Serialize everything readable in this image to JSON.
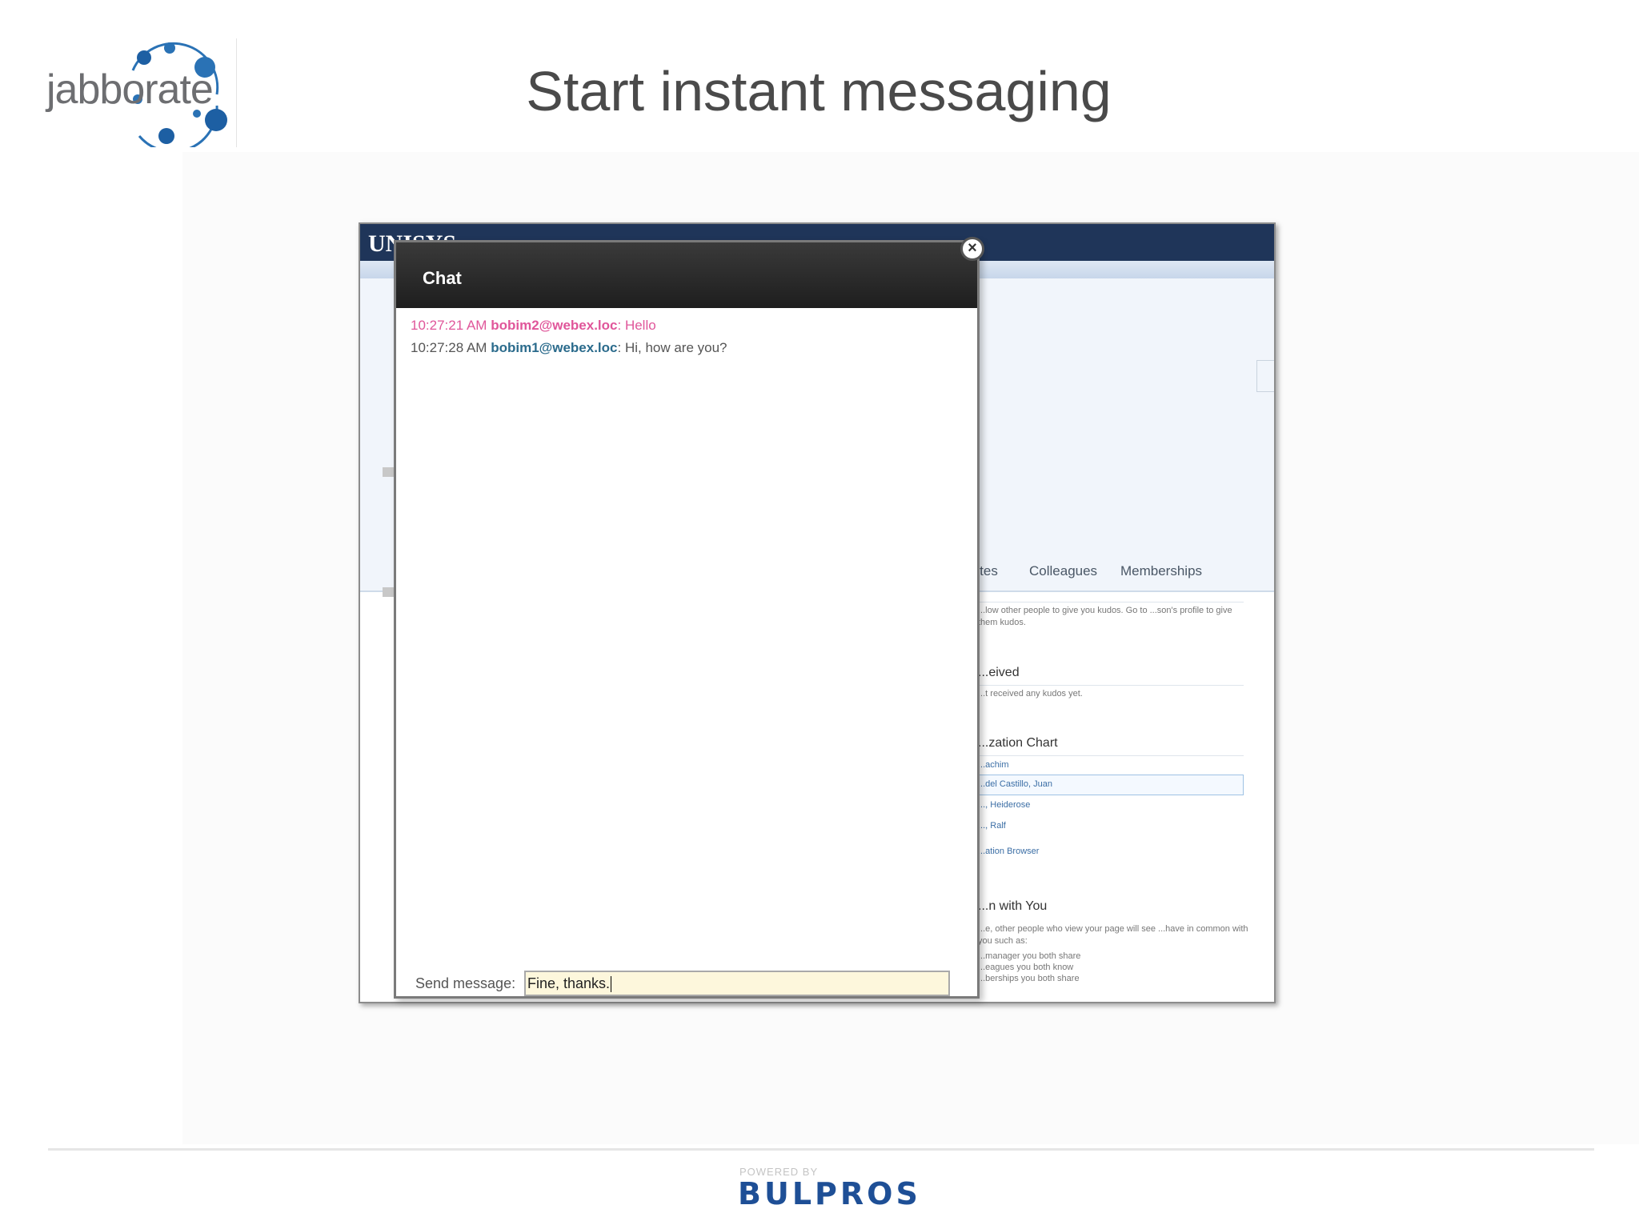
{
  "header": {
    "logo_text": "jabborate",
    "title": "Start instant messaging"
  },
  "sharepoint": {
    "brand": "UNISYS",
    "tabs": [
      "...tes",
      "Colleagues",
      "Memberships"
    ],
    "sections": {
      "kudos_note": "...low other people to give you kudos. Go to ...son's profile to give them kudos.",
      "received_heading": "...eived",
      "received_note": "...t received any kudos yet.",
      "org_chart_heading": "...zation Chart",
      "org_items": [
        "...achim",
        "...del Castillo, Juan",
        "..., Heiderose",
        "..., Ralf",
        "...ation Browser"
      ],
      "in_common_heading": "...n with You",
      "in_common_note": "...e, other people who view your page will see ...have in common with you such as:",
      "in_common_items": [
        "...manager you both share",
        "...eagues you both know",
        "...berships you both share"
      ]
    }
  },
  "chat": {
    "title": "Chat",
    "close_glyph": "×",
    "messages": [
      {
        "time": "10:27:21 AM",
        "sender": "bobim2@webex.loc",
        "text": "Hello",
        "direction": "in"
      },
      {
        "time": "10:27:28 AM",
        "sender": "bobim1@webex.loc",
        "text": "Hi, how are you?",
        "direction": "out"
      }
    ],
    "send_label": "Send message:",
    "input_value": "Fine, thanks."
  },
  "footer": {
    "powered_by": "POWERED BY",
    "brand": "BULPROS"
  },
  "colors": {
    "brand_blue": "#1e4f96",
    "incoming_msg": "#e0569a",
    "outgoing_sender": "#2b6b8c",
    "chat_header": "#2a2a2a",
    "sharepoint_bar": "#1f3559"
  }
}
